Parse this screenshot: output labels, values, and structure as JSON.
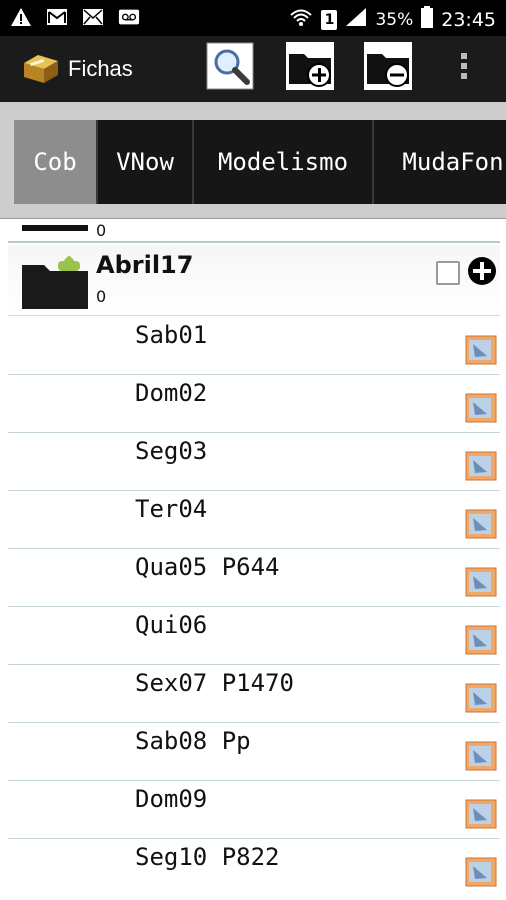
{
  "status_bar": {
    "icons": [
      "warning-icon",
      "gmail-icon",
      "mail-icon",
      "voicemail-icon"
    ],
    "wifi_icon": "wifi-icon",
    "sim_badge": "1",
    "signal_icon": "signal-icon",
    "battery": "35%",
    "time": "23:45"
  },
  "action_bar": {
    "title": "Fichas",
    "icons": [
      "search-icon",
      "folder-add-icon",
      "folder-remove-icon",
      "overflow-menu-icon"
    ]
  },
  "tabs": [
    {
      "label": "Cob",
      "selected": true
    },
    {
      "label": "VNow",
      "selected": false
    },
    {
      "label": "Modelismo",
      "selected": false
    },
    {
      "label": "MudaFon",
      "selected": false
    }
  ],
  "folder": {
    "previous_count": "0",
    "name": "Abril17",
    "count": "0"
  },
  "items": [
    {
      "label": "Sab01"
    },
    {
      "label": "Dom02"
    },
    {
      "label": "Seg03"
    },
    {
      "label": "Ter04"
    },
    {
      "label": "Qua05 P644"
    },
    {
      "label": "Qui06"
    },
    {
      "label": "Sex07 P1470"
    },
    {
      "label": "Sab08 Pp"
    },
    {
      "label": "Dom09"
    },
    {
      "label": "Seg10 P822"
    }
  ],
  "colors": {
    "action_bar": "#1b1b1b",
    "tab_selected": "#8d8d8d",
    "tab": "#161616",
    "note_icon": "#f2a766",
    "divider": "#c7d6d8"
  }
}
